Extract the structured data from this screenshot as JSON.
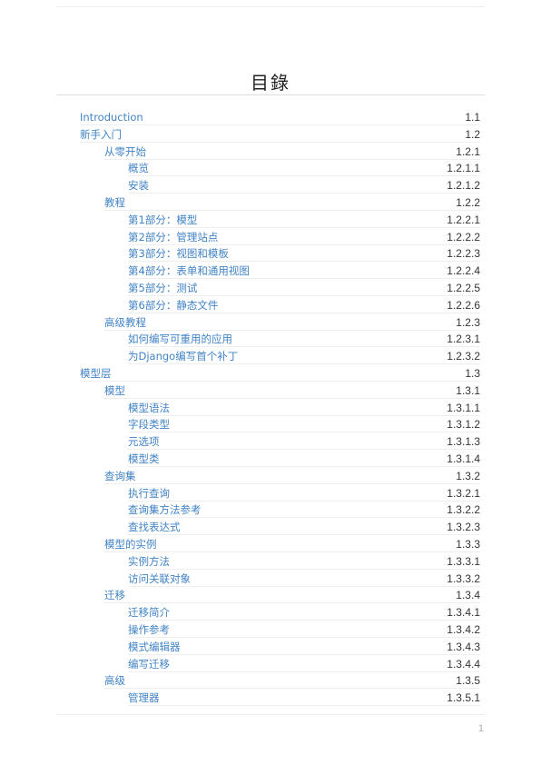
{
  "document": {
    "title": "目錄",
    "page_number": "1"
  },
  "toc": [
    {
      "label": "Introduction",
      "number": "1.1",
      "level": 0
    },
    {
      "label": "新手入门",
      "number": "1.2",
      "level": 0
    },
    {
      "label": "从零开始",
      "number": "1.2.1",
      "level": 1
    },
    {
      "label": "概览",
      "number": "1.2.1.1",
      "level": 2
    },
    {
      "label": "安装",
      "number": "1.2.1.2",
      "level": 2
    },
    {
      "label": "教程",
      "number": "1.2.2",
      "level": 1
    },
    {
      "label": "第1部分：模型",
      "number": "1.2.2.1",
      "level": 2
    },
    {
      "label": "第2部分：管理站点",
      "number": "1.2.2.2",
      "level": 2
    },
    {
      "label": "第3部分：视图和模板",
      "number": "1.2.2.3",
      "level": 2
    },
    {
      "label": "第4部分：表单和通用视图",
      "number": "1.2.2.4",
      "level": 2
    },
    {
      "label": "第5部分：测试",
      "number": "1.2.2.5",
      "level": 2
    },
    {
      "label": "第6部分：静态文件",
      "number": "1.2.2.6",
      "level": 2
    },
    {
      "label": "高级教程",
      "number": "1.2.3",
      "level": 1
    },
    {
      "label": "如何编写可重用的应用",
      "number": "1.2.3.1",
      "level": 2
    },
    {
      "label": "为Django编写首个补丁",
      "number": "1.2.3.2",
      "level": 2
    },
    {
      "label": "模型层",
      "number": "1.3",
      "level": 0
    },
    {
      "label": "模型",
      "number": "1.3.1",
      "level": 1
    },
    {
      "label": "模型语法",
      "number": "1.3.1.1",
      "level": 2
    },
    {
      "label": "字段类型",
      "number": "1.3.1.2",
      "level": 2
    },
    {
      "label": "元选项",
      "number": "1.3.1.3",
      "level": 2
    },
    {
      "label": "模型类",
      "number": "1.3.1.4",
      "level": 2
    },
    {
      "label": "查询集",
      "number": "1.3.2",
      "level": 1
    },
    {
      "label": "执行查询",
      "number": "1.3.2.1",
      "level": 2
    },
    {
      "label": "查询集方法参考",
      "number": "1.3.2.2",
      "level": 2
    },
    {
      "label": "查找表达式",
      "number": "1.3.2.3",
      "level": 2
    },
    {
      "label": "模型的实例",
      "number": "1.3.3",
      "level": 1
    },
    {
      "label": "实例方法",
      "number": "1.3.3.1",
      "level": 2
    },
    {
      "label": "访问关联对象",
      "number": "1.3.3.2",
      "level": 2
    },
    {
      "label": "迁移",
      "number": "1.3.4",
      "level": 1
    },
    {
      "label": "迁移简介",
      "number": "1.3.4.1",
      "level": 2
    },
    {
      "label": "操作参考",
      "number": "1.3.4.2",
      "level": 2
    },
    {
      "label": "模式编辑器",
      "number": "1.3.4.3",
      "level": 2
    },
    {
      "label": "编写迁移",
      "number": "1.3.4.4",
      "level": 2
    },
    {
      "label": "高级",
      "number": "1.3.5",
      "level": 1
    },
    {
      "label": "管理器",
      "number": "1.3.5.1",
      "level": 2
    }
  ],
  "colors": {
    "link": "#4183c4",
    "number": "#333333",
    "rule": "#eeeeee"
  }
}
